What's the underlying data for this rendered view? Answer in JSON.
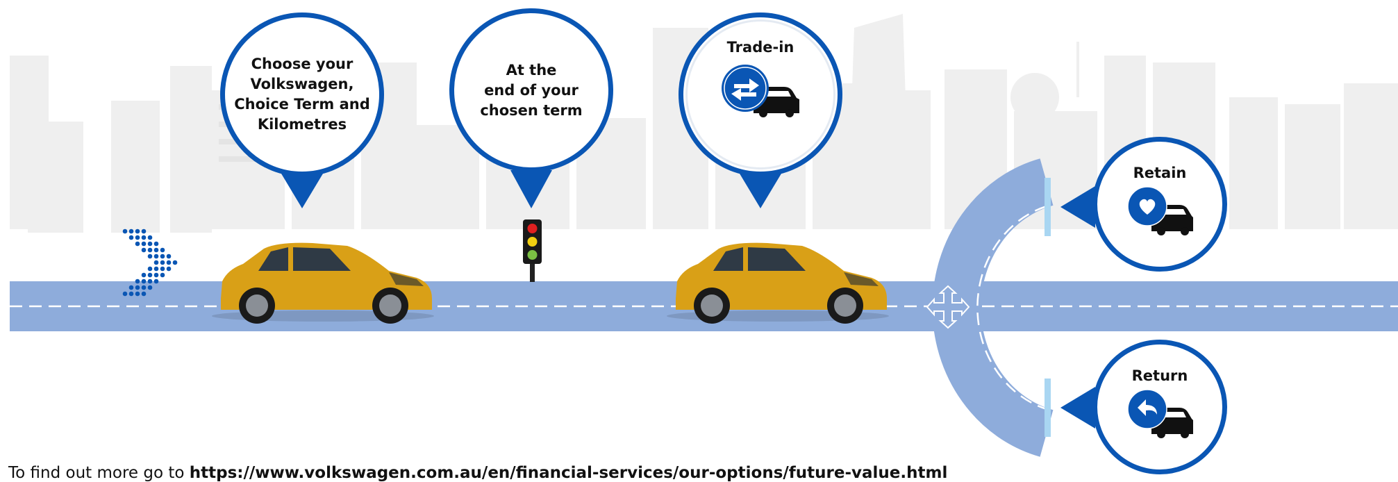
{
  "colors": {
    "road": "#8eacdb",
    "road_dash": "#ffffff",
    "brand_blue": "#0a56b4",
    "skyline": "#eeeeee",
    "car_body": "#d9a017",
    "signal_red": "#e02020",
    "signal_yellow": "#f2d011",
    "signal_green": "#7bc043",
    "marker": "#a9d6f2"
  },
  "steps": [
    {
      "id": "choose",
      "text": "Choose your\nVolkswagen,\nChoice Term and\nKilometres",
      "icon": ""
    },
    {
      "id": "end-term",
      "text": "At the\nend of your\nchosen term",
      "icon": ""
    },
    {
      "id": "trade-in",
      "text": "Trade-in",
      "icon": "swap-arrows-car-icon"
    }
  ],
  "options": [
    {
      "id": "retain",
      "text": "Retain",
      "icon": "heart-car-icon"
    },
    {
      "id": "return",
      "text": "Return",
      "icon": "return-arrow-car-icon"
    }
  ],
  "icons": {
    "start": "chevron-dots-icon",
    "signal": "traffic-light-icon",
    "junction": "four-way-arrows-icon",
    "vehicle": "hatchback-car-icon"
  },
  "footer": {
    "prefix": "To find out more go to ",
    "link": "https://www.volkswagen.com.au/en/financial-services/our-options/future-value.html"
  }
}
